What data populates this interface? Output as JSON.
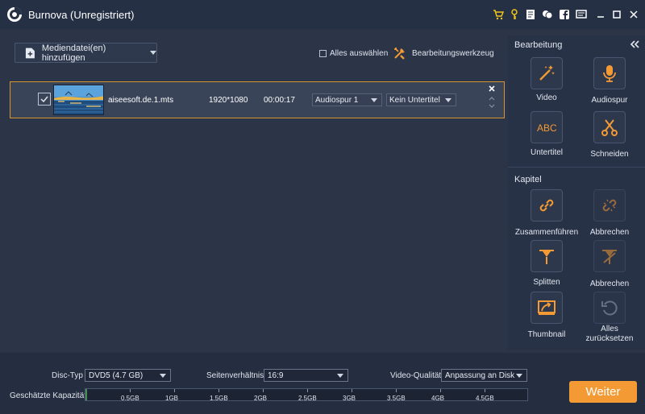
{
  "window": {
    "title": "Burnova (Unregistriert)"
  },
  "toolbar": {
    "add_media_label": "Mediendatei(en) hinzufügen",
    "select_all_label": "Alles auswählen",
    "edit_tool_label": "Bearbeitungswerkzeug"
  },
  "file_row": {
    "filename": "aiseesoft.de.1.mts",
    "resolution": "1920*1080",
    "duration": "00:00:17",
    "audio_track": "Audiospur 1",
    "subtitle": "Kein Untertitel",
    "checked": true
  },
  "panel": {
    "editing_title": "Bearbeitung",
    "editing_tools": [
      {
        "label": "Video",
        "icon": "magic-wand-icon"
      },
      {
        "label": "Audiospur",
        "icon": "microphone-icon"
      },
      {
        "label": "Untertitel",
        "icon": "abc-text-icon"
      },
      {
        "label": "Schneiden",
        "icon": "scissors-icon"
      }
    ],
    "chapter_title": "Kapitel",
    "chapter_tools": [
      {
        "label": "Zusammenführen",
        "icon": "link-icon"
      },
      {
        "label": "Abbrechen",
        "icon": "broken-link-icon"
      },
      {
        "label": "Splitten",
        "icon": "split-icon"
      },
      {
        "label": "Abbrechen",
        "icon": "split-cancel-icon"
      },
      {
        "label": "Thumbnail",
        "icon": "thumbnail-icon"
      },
      {
        "label": "Alles zurücksetzen",
        "icon": "reset-icon"
      }
    ]
  },
  "bottom": {
    "disc_type_label": "Disc-Typ",
    "disc_type_value": "DVD5 (4.7 GB)",
    "aspect_label": "Seitenverhältnis:",
    "aspect_value": "16:9",
    "quality_label": "Video-Qualität:",
    "quality_value": "Anpassung an Disk",
    "capacity_label": "Geschätzte Kapazität:",
    "capacity_ticks": [
      "0.5GB",
      "1GB",
      "1.5GB",
      "2GB",
      "2.5GB",
      "3GB",
      "3.5GB",
      "4GB",
      "4.5GB"
    ],
    "capacity_used_fraction": 0.003,
    "next_label": "Weiter"
  },
  "colors": {
    "accent": "#f39a34",
    "selection_border": "#d79433",
    "title_icons": "#f0c419"
  }
}
